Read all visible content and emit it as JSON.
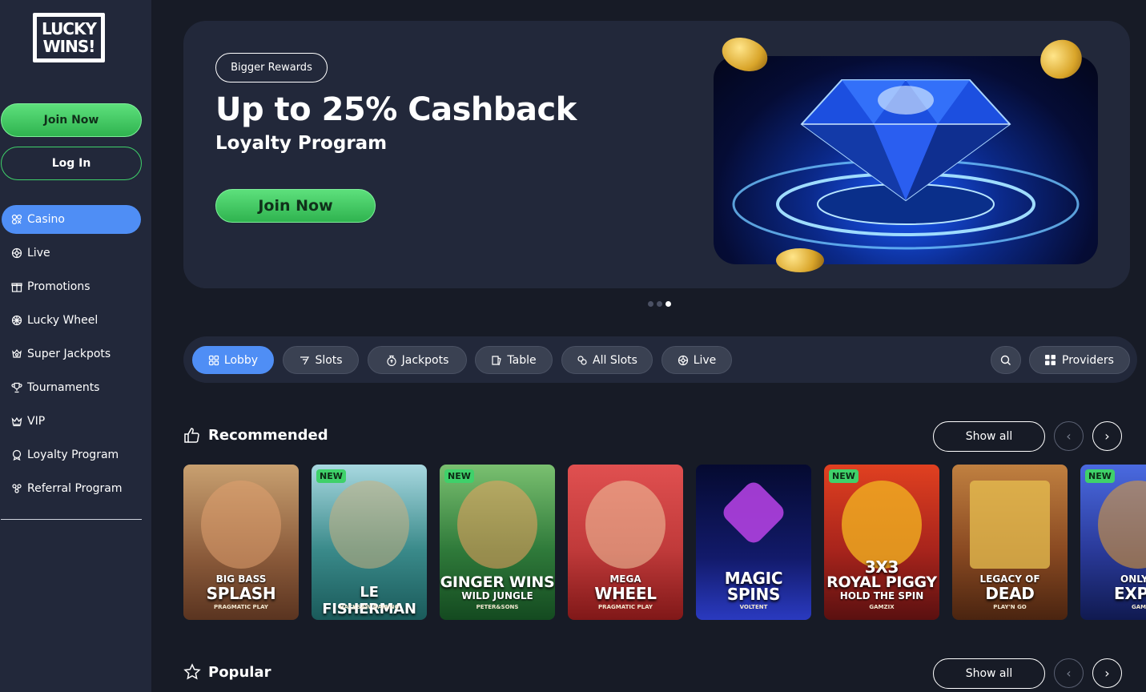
{
  "logo": {
    "line1": "LUCKY",
    "line2": "WINS!"
  },
  "auth": {
    "join": "Join Now",
    "login": "Log In"
  },
  "nav": [
    {
      "label": "Casino",
      "icon": "casino-icon",
      "active": true
    },
    {
      "label": "Live",
      "icon": "live-icon"
    },
    {
      "label": "Promotions",
      "icon": "gift-icon"
    },
    {
      "label": "Lucky Wheel",
      "icon": "wheel-icon"
    },
    {
      "label": "Super Jackpots",
      "icon": "jackpot-icon"
    },
    {
      "label": "Tournaments",
      "icon": "trophy-icon"
    },
    {
      "label": "VIP",
      "icon": "crown-icon"
    },
    {
      "label": "Loyalty Program",
      "icon": "loyalty-icon"
    },
    {
      "label": "Referral Program",
      "icon": "referral-icon"
    }
  ],
  "hero": {
    "badge": "Bigger Rewards",
    "title": "Up to 25% Cashback",
    "subtitle": "Loyalty Program",
    "cta": "Join Now"
  },
  "categories": [
    {
      "label": "Lobby",
      "icon": "lobby-icon",
      "active": true
    },
    {
      "label": "Slots",
      "icon": "slots-icon"
    },
    {
      "label": "Jackpots",
      "icon": "jackpots-icon"
    },
    {
      "label": "Table",
      "icon": "table-icon"
    },
    {
      "label": "All Slots",
      "icon": "all-slots-icon"
    },
    {
      "label": "Live",
      "icon": "live-icon"
    }
  ],
  "providers_label": "Providers",
  "recommended": {
    "title": "Recommended",
    "show_all": "Show all",
    "games": [
      {
        "line1": "BIG BASS",
        "line2": "SPLASH",
        "provider": "PRAGMATIC PLAY",
        "new": false,
        "bg": "#8a5a3a"
      },
      {
        "line1": "",
        "line2": "LE FISHERMAN",
        "provider": "HACKSAW GAMING",
        "new": true,
        "bg": "#2c7a8a"
      },
      {
        "line1": "",
        "line2": "GINGER WINS",
        "line2b": "WILD JUNGLE",
        "provider": "PETER&SONS",
        "new": true,
        "bg": "#2f7a3a"
      },
      {
        "line1": "MEGA",
        "line2": "WHEEL",
        "provider": "PRAGMATIC PLAY",
        "new": false,
        "bg": "#c03a3a"
      },
      {
        "line1": "MAGIC",
        "line2": "SPINS",
        "provider": "VOLTENT",
        "new": false,
        "bg": "#121a6a"
      },
      {
        "line1": "3X3",
        "line2": "ROYAL PIGGY",
        "line2b": "HOLD THE SPIN",
        "provider": "GAMZIX",
        "new": true,
        "bg": "#a8241c"
      },
      {
        "line1": "LEGACY OF",
        "line2": "DEAD",
        "provider": "PLAY'N GO",
        "new": false,
        "bg": "#8a4a22"
      },
      {
        "line1": "ONLY C",
        "line2": "EXPR",
        "provider": "GAMZI",
        "new": true,
        "bg": "#2a3a9a"
      }
    ]
  },
  "popular": {
    "title": "Popular",
    "show_all": "Show all"
  }
}
